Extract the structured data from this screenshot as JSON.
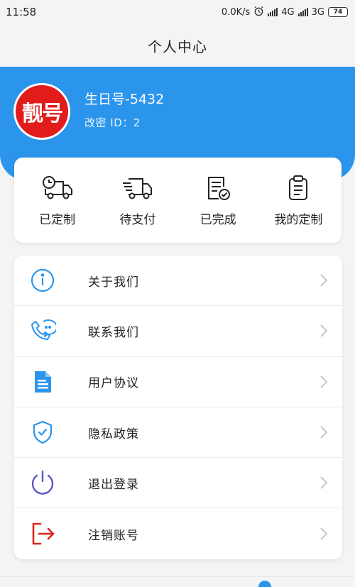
{
  "status_bar": {
    "time": "11:58",
    "speed": "0.0K/s",
    "net1": "4G",
    "net2": "3G",
    "battery": "74",
    "icons": [
      "alarm-icon",
      "signal-hd-icon",
      "signal-icon"
    ]
  },
  "nav": {
    "title": "个人中心"
  },
  "colors": {
    "accent": "#2b95ec",
    "avatar_bg": "#e21b1b"
  },
  "profile": {
    "avatar_text": "靓号",
    "name": "生日号-5432",
    "id_line": "改密 ID：2"
  },
  "orders": [
    {
      "label": "已定制",
      "icon": "truck-clock-icon"
    },
    {
      "label": "待支付",
      "icon": "fast-delivery-icon"
    },
    {
      "label": "已完成",
      "icon": "document-check-icon"
    },
    {
      "label": "我的定制",
      "icon": "clipboard-list-icon"
    }
  ],
  "menu": [
    {
      "label": "关于我们",
      "icon": "info-icon"
    },
    {
      "label": "联系我们",
      "icon": "phone-chat-icon"
    },
    {
      "label": "用户协议",
      "icon": "agreement-document-icon"
    },
    {
      "label": "隐私政策",
      "icon": "privacy-shield-icon"
    },
    {
      "label": "退出登录",
      "icon": "power-icon"
    },
    {
      "label": "注销账号",
      "icon": "logout-arrow-icon"
    }
  ]
}
